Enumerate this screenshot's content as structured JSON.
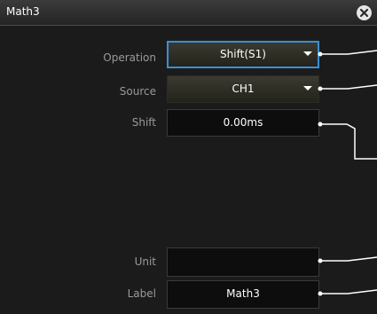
{
  "dialog": {
    "title": "Math3",
    "close_icon": "close-x-circle-icon"
  },
  "form": {
    "operation": {
      "label": "Operation",
      "value": "Shift(S1)"
    },
    "source": {
      "label": "Source",
      "value": "CH1"
    },
    "shift": {
      "label": "Shift",
      "value": "0.00ms"
    },
    "unit": {
      "label": "Unit",
      "value": ""
    },
    "label": {
      "label": "Label",
      "value": "Math3"
    }
  },
  "colors": {
    "focus_border": "#3b8fd6",
    "background": "#1b1b1b",
    "label_text": "#9a9a9a"
  }
}
